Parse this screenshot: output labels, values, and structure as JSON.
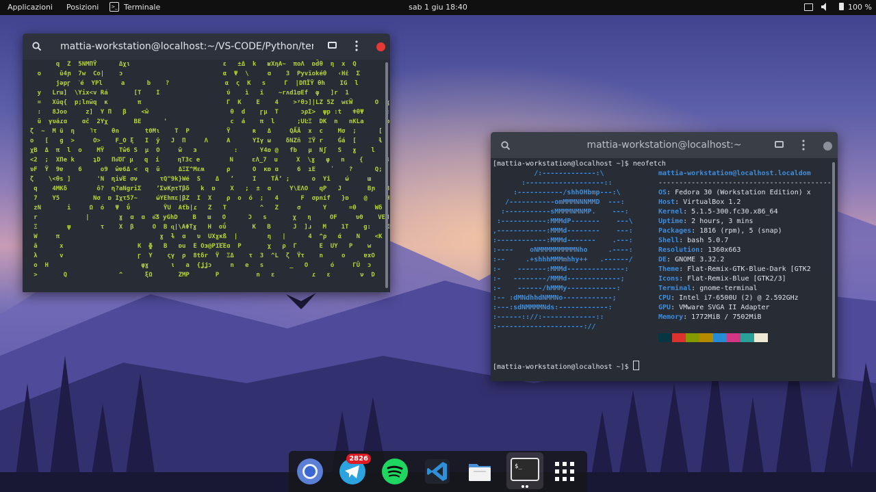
{
  "topbar": {
    "applications": "Applicazioni",
    "places": "Posizioni",
    "app_name": "Terminale",
    "clock": "sab 1 giu  18:40",
    "battery": "100 %"
  },
  "matrix_window": {
    "title": "mattia-workstation@localhost:~/VS-CODE/Python/termi...",
    "lines": [
      "         q  Z  5NMΠŸ      Δχι                         ε   ±Δ  k   ʁXηA~  ποΛ  ɒd̃θ  η  x  Q",
      "    ο     ū4ɲ  7w  Cο|    ɔ                           α  Ψ  \\     ɑ    3  Ρyvïokéθ   ‹Ηἐ  Σ            G",
      "         jǝpɼ  ˋé  YPl     a      b    ?               α  ς  Κ   s     Γ  |DΠΪŸ θh    IG  l             7",
      "    y   Lrɯ]  \\Yix<v Rá       [T    I                  ύ    ì   ï    ~rʌd1ʊEf  φ   ]r  1             1",
      "    =   Xũq{  p;lnw̃q  κ        π                       Γ  K    E    4    >ʸθɔ]|LZ 5Z  wɛẄ      Ο  ɣ   χ",
      "    :   8Jοo     z]  Y Π   β    <ŵ                      θ  d    ɼμ  Τ      ɔρΣ>  ψp :t   ǂθΨ      :  [   F",
      "    ū  γυáɾɑ    ɑĉ  2Yχ       ΒΕ      '                 c  á    π  l      ;UĿΞ  DK  n   nKLa      b  ı    i",
      "  ζ  ~  Μ ü  η    ˥τ    θn       tΘΜι    Τ  Ρ          Ÿ      ʀ   Δ     QA̋Ä  x  c    Mσ  ;      [   Β   Γ",
      "  ο   [   ɡ  >     O>    F_O ξ   Ι  ŷ   Ϳ  Π     Λ     Α      ΥΙγ ω    δNZñ  ΞŸ r    Ǵá  [      ɬ   M",
      "  χΒ  Δ  π  l  ο    ΜŸ    Tŵ6 S  μ  Ο     ŵ   ɜ          :      Υ4ɒ @   fb   µ  Nʃ   S   ɣ    l      ΣδΚ  ο",
      "  <2  ;  XΠe k     ʇD   Πο͂ƱΓ μ   q  í     ηΤ3c e        Ν     εΛ_7  u     Χ  \\ɣ   φ   n    {      3    }",
      "  ʋF  Ÿ  9ɐ    6     ο9  ŵɐ6Δ <  q  ū     ΔΞΣ^Мɛʍ      ρ      Ο  κɒ ɑ     6  ıΕ    ʹ    ?      Q;   d",
      "  ζ    \\<θs ]       'Ν  ɳiνΈ σν      τQ\"9k}Wé  S    Δ   ʼ     Ι    ΤÂʼ ;      ο  Υî    ώ     ш     ɔCɔ  ɪΗ",
      "   q    4ΜΚδ        ô?  ɳ?aNgriΣ    ʼΣνΚɲτΤβδ   k  ɒ    Χ   ;  ±  ɑ     Y\\ΕΛΟ   qP   J       Βɲ   8|",
      "   7    Y5         Νσ  ɒ Ιχτ57~     ώΥΕhπε|βΖ  Ι  Χ    ρ  ο  ó  ;   4      Ϝ  σpníf   }ɒ    @     Hr  <ɔ",
      "   zΝ       i     Ω  ό   Ψ  ΰ         ŶU  Αťb|ɾ   Ζ   Τ         ^   Ζ     σ      Υ      =θ     Wδ    φmΑ  3",
      "   r             |        ɣ  ɑ  ɑ  ο͂Ʒ yGhD    Β   ɯ   Ο      Ͻ   s       χ   η     OF     ʋΘ    VEΠ  R",
      "   Ξ        ψ        τ    Χ  β     Ο  Β ɋ|\\ΑΦTɣ   Η  οΰ       Κ   Β      Ϳ  ]ɹ   Μ    1Τ    g:    ΧΠΒ  i",
      "   W     π                           ɣ  ɫ  ɑ   υ  UΧɣκß  |        η   |      4  ^ρ   ά    Ν    <Κ     γ   y",
      "   ā      x                    Κ  ɸ   Β   ɒu  Ε Οɜ@Ρ1ΈΈɑ  Ρ       χ   ρ  Γ      Ε  UΥ   Ρ    w      5     h3  Ε",
      "   λ      v                    ɼ  Y    ςγ  ρ  8tδr  Ÿ  ΞΔ    τ  3  ^L  ζ  Ÿτ    n     ο     ɐxΟ         η",
      "   ο  Η                         φɣ      ι   a  {ʝʝɔ     n   e   s       _   Ο      ó     ΓŪ  ɔ         Ε",
      "   >       Q              ^      ξΩ       ZΜΡ       Ρ          n   ε          ɾ   ε        ν  D         π"
    ]
  },
  "neofetch_window": {
    "title": "mattia-workstation@localhost:~",
    "prompt": "[mattia-workstation@localhost ~]$ neofetch",
    "prompt_end": "[mattia-workstation@localhost ~]$ ",
    "logo_lines": [
      "          /:-------------:\\",
      "       :-------------------::",
      "     :-----------/shhOHbmp---:\\",
      "   /-----------omMMMNNNMMD  ---:",
      "  :-----------sMMMMNMNMP.    ---:",
      " :-----------:MMMdP-------    ---\\",
      ",------------:MMMd--------    ---:",
      ":------------:MMMd-------    .---:",
      ":----    oNMMMMMMMMMNho     .----:",
      ":--     .+shhhMMMmhhy++   .------/",
      ":-    -------:MMMd--------------:",
      ":-   --------/MMMd-------------;",
      ":-    ------/hMMMy------------:",
      ":-- :dMNdhhdNMMNo------------;",
      ":---:sdNMMMMNds:------------:",
      ":------:://:-------------::",
      ":---------------------://"
    ],
    "user_host": "mattia-workstation@localhost.localdom",
    "separator": "-------------------------------------------",
    "info": [
      {
        "key": "OS",
        "value": "Fedora 30 (Workstation Edition) x"
      },
      {
        "key": "Host",
        "value": "VirtualBox 1.2"
      },
      {
        "key": "Kernel",
        "value": "5.1.5-300.fc30.x86_64"
      },
      {
        "key": "Uptime",
        "value": "2 hours, 3 mins"
      },
      {
        "key": "Packages",
        "value": "1816 (rpm), 5 (snap)"
      },
      {
        "key": "Shell",
        "value": "bash 5.0.7"
      },
      {
        "key": "Resolution",
        "value": "1360x663"
      },
      {
        "key": "DE",
        "value": "GNOME 3.32.2"
      },
      {
        "key": "Theme",
        "value": "Flat-Remix-GTK-Blue-Dark [GTK2"
      },
      {
        "key": "Icons",
        "value": "Flat-Remix-Blue [GTK2/3]"
      },
      {
        "key": "Terminal",
        "value": "gnome-terminal"
      },
      {
        "key": "CPU",
        "value": "Intel i7-6500U (2) @ 2.592GHz"
      },
      {
        "key": "GPU",
        "value": "VMware SVGA II Adapter"
      },
      {
        "key": "Memory",
        "value": "1772MiB / 7502MiB"
      }
    ],
    "palette": [
      "#073642",
      "#dc322f",
      "#859900",
      "#b58900",
      "#268bd2",
      "#d33682",
      "#2aa198",
      "#eee8d5"
    ]
  },
  "dock": {
    "apps": [
      "chrome-icon",
      "telegram-icon",
      "spotify-icon",
      "vscode-icon",
      "files-icon",
      "terminal-icon",
      "app-grid-icon"
    ],
    "telegram_badge": "2826"
  }
}
